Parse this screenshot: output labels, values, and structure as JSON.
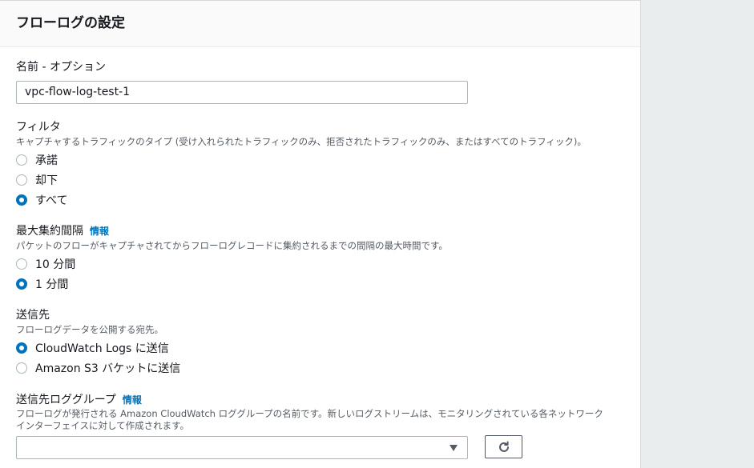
{
  "panel": {
    "title": "フローログの設定"
  },
  "name_field": {
    "label": "名前 - オプション",
    "value": "vpc-flow-log-test-1"
  },
  "filter": {
    "label": "フィルタ",
    "description": "キャプチャするトラフィックのタイプ (受け入れられたトラフィックのみ、拒否されたトラフィックのみ、またはすべてのトラフィック)。",
    "options": [
      {
        "label": "承諾",
        "selected": false
      },
      {
        "label": "却下",
        "selected": false
      },
      {
        "label": "すべて",
        "selected": true
      }
    ]
  },
  "aggregation": {
    "label": "最大集約間隔",
    "info": "情報",
    "description": "パケットのフローがキャプチャされてからフローログレコードに集約されるまでの間隔の最大時間です。",
    "options": [
      {
        "label": "10 分間",
        "selected": false
      },
      {
        "label": "1 分間",
        "selected": true
      }
    ]
  },
  "destination": {
    "label": "送信先",
    "description": "フローログデータを公開する宛先。",
    "options": [
      {
        "label": "CloudWatch Logs に送信",
        "selected": true
      },
      {
        "label": "Amazon S3 バケットに送信",
        "selected": false
      }
    ]
  },
  "log_group": {
    "label": "送信先ロググループ",
    "info": "情報",
    "description_line1": "フローログが発行される Amazon CloudWatch ロググループの名前です。新しいログストリームは、モニタリングされている各ネットワーク",
    "description_line2": "インターフェイスに対して作成されます。",
    "selected_value": ""
  },
  "icons": {
    "dropdown": "chevron-down-icon",
    "refresh": "refresh-icon"
  },
  "colors": {
    "accent": "#0073bb",
    "text": "#16191f",
    "secondary_text": "#545b64"
  }
}
